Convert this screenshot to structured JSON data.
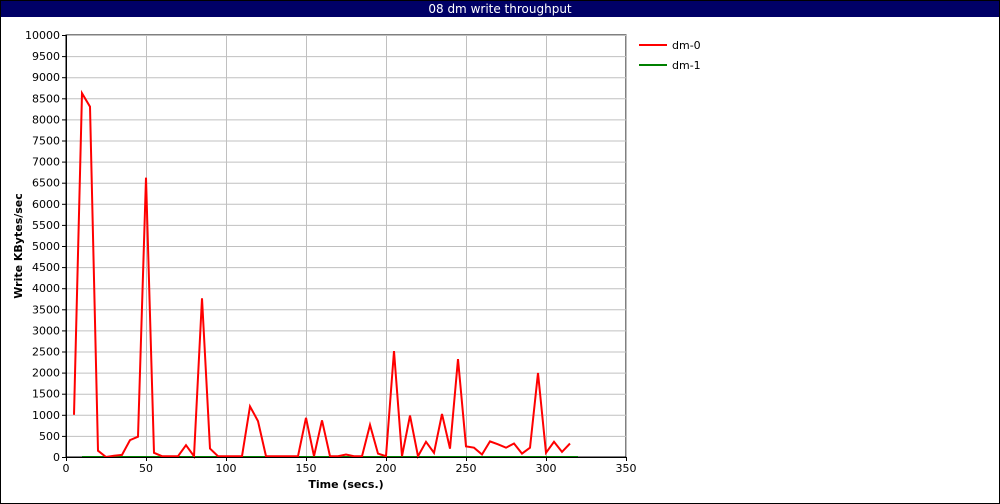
{
  "window": {
    "title": "08 dm write throughput"
  },
  "chart_data": {
    "type": "line",
    "title": "08 dm write throughput",
    "xlabel": "Time (secs.)",
    "ylabel": "Write KBytes/sec",
    "xlim": [
      0,
      350
    ],
    "ylim": [
      0,
      10000
    ],
    "xticks": [
      0,
      50,
      100,
      150,
      200,
      250,
      300,
      350
    ],
    "yticks": [
      0,
      500,
      1000,
      1500,
      2000,
      2500,
      3000,
      3500,
      4000,
      4500,
      5000,
      5500,
      6000,
      6500,
      7000,
      7500,
      8000,
      8500,
      9000,
      9500,
      10000
    ],
    "grid": true,
    "legend_position": "top-right outside plot",
    "series": [
      {
        "name": "dm-0",
        "color": "#ff0000",
        "points": [
          [
            5,
            1000
          ],
          [
            10,
            8620
          ],
          [
            15,
            8300
          ],
          [
            20,
            150
          ],
          [
            25,
            0
          ],
          [
            30,
            30
          ],
          [
            35,
            50
          ],
          [
            40,
            400
          ],
          [
            45,
            480
          ],
          [
            50,
            6620
          ],
          [
            55,
            100
          ],
          [
            60,
            20
          ],
          [
            65,
            20
          ],
          [
            70,
            20
          ],
          [
            75,
            280
          ],
          [
            80,
            20
          ],
          [
            85,
            3760
          ],
          [
            90,
            200
          ],
          [
            95,
            20
          ],
          [
            100,
            20
          ],
          [
            105,
            20
          ],
          [
            110,
            20
          ],
          [
            115,
            1200
          ],
          [
            120,
            850
          ],
          [
            125,
            20
          ],
          [
            130,
            20
          ],
          [
            135,
            20
          ],
          [
            140,
            20
          ],
          [
            145,
            20
          ],
          [
            150,
            930
          ],
          [
            155,
            20
          ],
          [
            160,
            870
          ],
          [
            165,
            20
          ],
          [
            170,
            20
          ],
          [
            175,
            60
          ],
          [
            180,
            20
          ],
          [
            185,
            20
          ],
          [
            190,
            760
          ],
          [
            195,
            80
          ],
          [
            200,
            20
          ],
          [
            205,
            2510
          ],
          [
            210,
            20
          ],
          [
            215,
            980
          ],
          [
            220,
            20
          ],
          [
            225,
            360
          ],
          [
            230,
            100
          ],
          [
            235,
            1020
          ],
          [
            240,
            200
          ],
          [
            245,
            2320
          ],
          [
            250,
            250
          ],
          [
            255,
            220
          ],
          [
            260,
            60
          ],
          [
            265,
            370
          ],
          [
            270,
            300
          ],
          [
            275,
            220
          ],
          [
            280,
            320
          ],
          [
            285,
            80
          ],
          [
            290,
            220
          ],
          [
            295,
            1990
          ],
          [
            300,
            100
          ],
          [
            305,
            360
          ],
          [
            310,
            120
          ],
          [
            315,
            320
          ]
        ]
      },
      {
        "name": "dm-1",
        "color": "#008000",
        "points": [
          [
            10,
            0
          ],
          [
            50,
            0
          ],
          [
            100,
            0
          ],
          [
            150,
            0
          ],
          [
            200,
            0
          ],
          [
            250,
            0
          ],
          [
            300,
            0
          ],
          [
            320,
            0
          ]
        ]
      }
    ]
  }
}
